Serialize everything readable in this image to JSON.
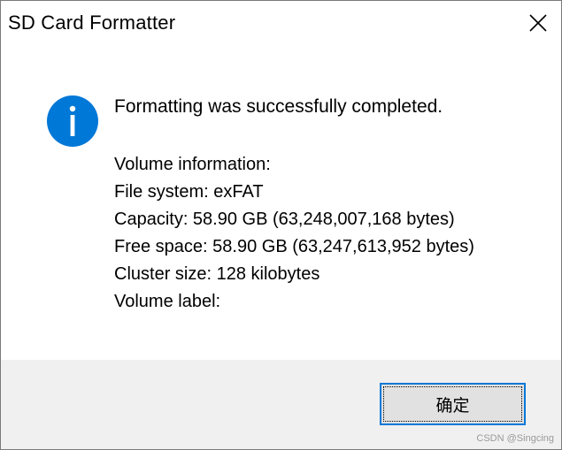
{
  "window": {
    "title": "SD Card Formatter",
    "close_icon": "close-icon"
  },
  "message": {
    "icon": "info-icon",
    "icon_color": "#0078d7",
    "text": "Formatting was successfully completed."
  },
  "details": {
    "heading": "Volume information:",
    "file_system": "File system: exFAT",
    "capacity": "Capacity: 58.90 GB (63,248,007,168 bytes)",
    "free_space": "Free space: 58.90 GB (63,247,613,952 bytes)",
    "cluster_size": "Cluster size: 128 kilobytes",
    "volume_label": "Volume label:"
  },
  "footer": {
    "ok_label": "确定"
  },
  "watermark": "CSDN @Singcing"
}
